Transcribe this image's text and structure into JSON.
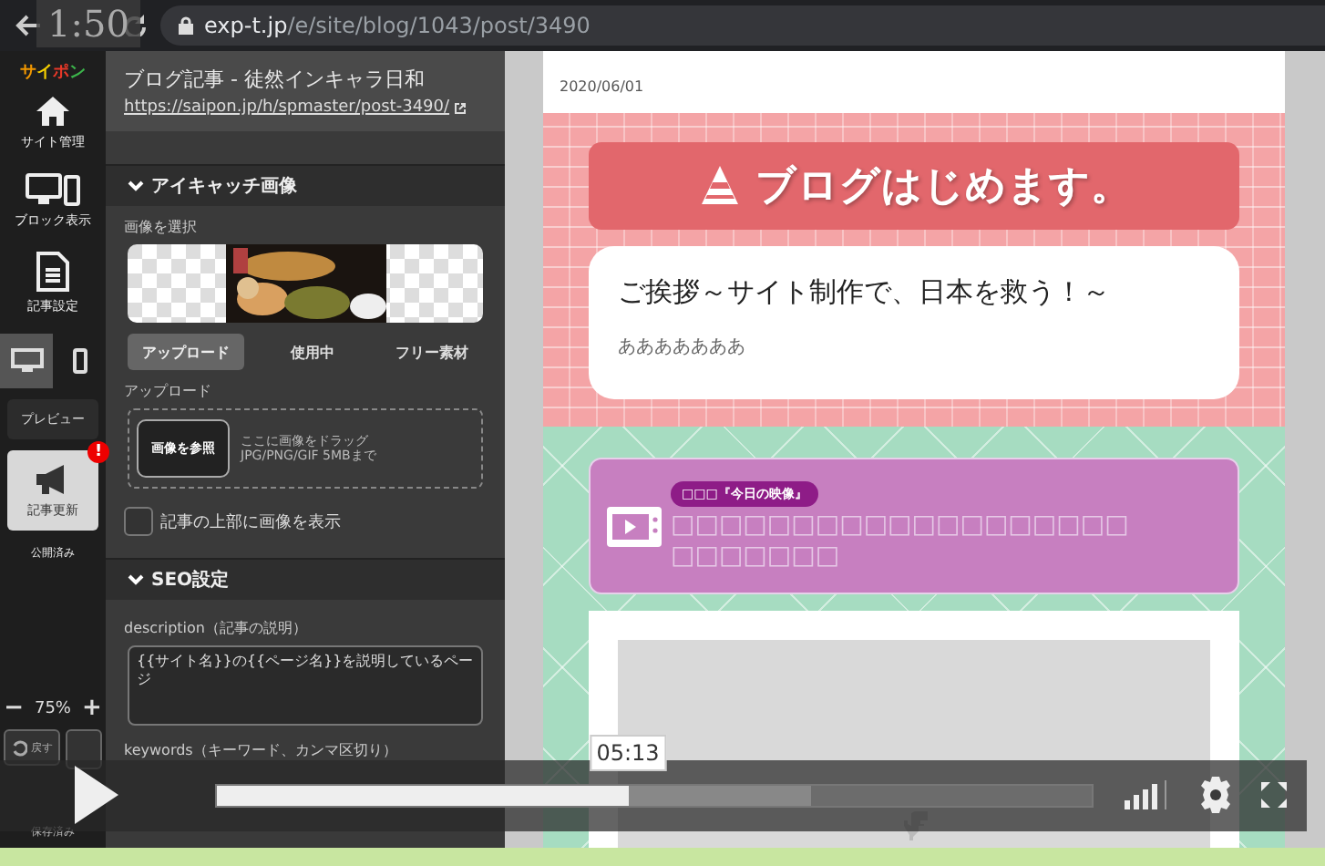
{
  "browser": {
    "time_overlay": "1:50",
    "url_domain": "exp-t.jp",
    "url_path": "/e/site/blog/1043/post/3490"
  },
  "sidebar": {
    "logo": "サイポン",
    "nav": [
      {
        "label": "サイト管理"
      },
      {
        "label": "ブロック表示"
      },
      {
        "label": "記事設定"
      }
    ],
    "devices": [
      {
        "kind": "desktop",
        "selected": true
      },
      {
        "kind": "phone",
        "selected": false
      }
    ],
    "preview_button": "プレビュー",
    "update_button": "記事更新",
    "update_badge": "!",
    "publish_status": "公開済み",
    "zoom": {
      "minus": "−",
      "value": "75%",
      "plus": "+"
    },
    "undo_button": "戻す",
    "save_status": "保存済み"
  },
  "panel": {
    "title": "ブログ記事 - 徒然インキャラ日和",
    "link": "https://saipon.jp/h/spmaster/post-3490/",
    "eyecatch": {
      "heading": "アイキャッチ画像",
      "expanded": true,
      "select_label": "画像を選択",
      "tabs": [
        {
          "label": "アップロード",
          "selected": true
        },
        {
          "label": "使用中",
          "selected": false
        },
        {
          "label": "フリー素材",
          "selected": false
        }
      ],
      "upload_label": "アップロード",
      "browse_button": "画像を参照",
      "drop_hint": "ここに画像をドラッグ",
      "drop_formats": "JPG/PNG/GIF 5MBまで",
      "show_on_top": {
        "label": "記事の上部に画像を表示",
        "checked": false
      }
    },
    "seo": {
      "heading": "SEO設定",
      "expanded": true,
      "description_label": "description（記事の説明）",
      "description_value": "{{サイト名}}の{{ページ名}}を説明しているページ",
      "keywords_label": "keywords（キーワード、カンマ区切り）"
    }
  },
  "preview": {
    "date": "2020/06/01",
    "banner": "ブログはじめます。",
    "greeting_title": "ご挨拶～サイト制作で、日本を救う！～",
    "greeting_body": "あああああああ",
    "video_box": {
      "badge": "□□□『今日の映像』",
      "text": "□□□□□□□□□□□□□□□□□□□□□□□□□□"
    }
  },
  "player": {
    "progress": {
      "level": 0.47
    },
    "buffer": {
      "level": 0.68
    },
    "tooltip": "05:13"
  }
}
